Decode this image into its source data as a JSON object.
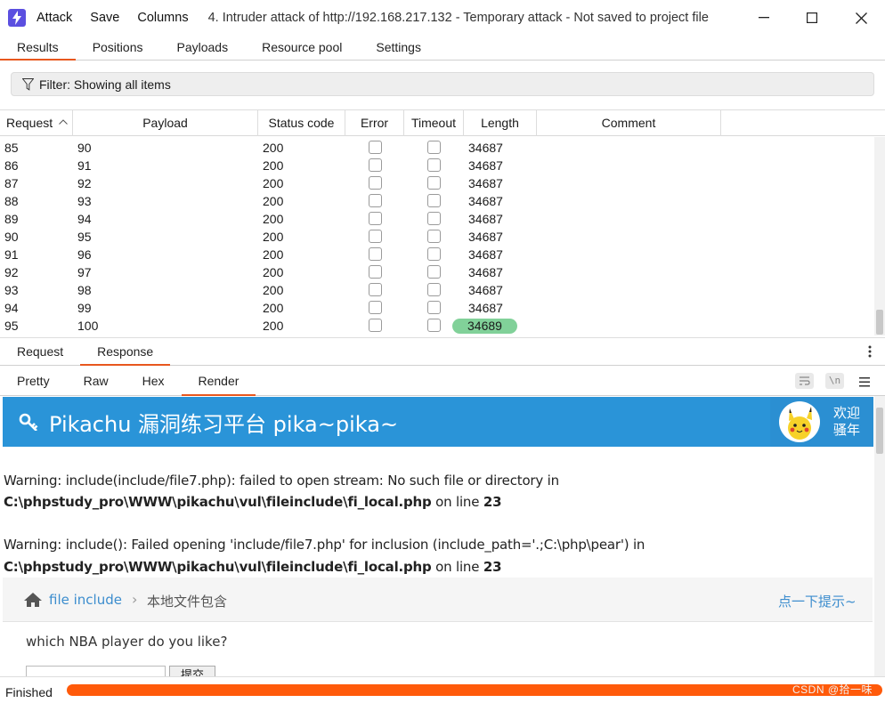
{
  "titlebar": {
    "menu": [
      "Attack",
      "Save",
      "Columns"
    ],
    "title": "4. Intruder attack of http://192.168.217.132 - Temporary attack - Not saved to project file"
  },
  "tabs": [
    "Results",
    "Positions",
    "Payloads",
    "Resource pool",
    "Settings"
  ],
  "filter": {
    "label": "Filter: Showing all items"
  },
  "table": {
    "columns": [
      "Request",
      "Payload",
      "Status code",
      "Error",
      "Timeout",
      "Length",
      "Comment"
    ],
    "rows": [
      {
        "request": "85",
        "payload": "90",
        "status": "200",
        "length": "34687"
      },
      {
        "request": "86",
        "payload": "91",
        "status": "200",
        "length": "34687"
      },
      {
        "request": "87",
        "payload": "92",
        "status": "200",
        "length": "34687"
      },
      {
        "request": "88",
        "payload": "93",
        "status": "200",
        "length": "34687"
      },
      {
        "request": "89",
        "payload": "94",
        "status": "200",
        "length": "34687"
      },
      {
        "request": "90",
        "payload": "95",
        "status": "200",
        "length": "34687"
      },
      {
        "request": "91",
        "payload": "96",
        "status": "200",
        "length": "34687"
      },
      {
        "request": "92",
        "payload": "97",
        "status": "200",
        "length": "34687"
      },
      {
        "request": "93",
        "payload": "98",
        "status": "200",
        "length": "34687"
      },
      {
        "request": "94",
        "payload": "99",
        "status": "200",
        "length": "34687"
      },
      {
        "request": "95",
        "payload": "100",
        "status": "200",
        "length": "34689",
        "highlight": true
      }
    ],
    "highlight_color": "#81d199"
  },
  "reqres_tabs": [
    "Request",
    "Response"
  ],
  "view_tabs": [
    "Pretty",
    "Raw",
    "Hex",
    "Render"
  ],
  "render": {
    "banner_title": "Pikachu 漏洞练习平台 pika~pika~",
    "welcome_1": "欢迎",
    "welcome_2": "骚年",
    "warn1_label": "Warning",
    "warn1_text": ": include(include/file7.php): failed to open stream: No such file or directory in",
    "warn1_path": "C:\\phpstudy_pro\\WWW\\pikachu\\vul\\fileinclude\\fi_local.php",
    "warn1_online": " on line ",
    "warn1_line": "23",
    "warn2_label": "Warning",
    "warn2_text": ": include(): Failed opening 'include/file7.php' for inclusion (include_path='.;C:\\php\\pear') in",
    "warn2_path": "C:\\phpstudy_pro\\WWW\\pikachu\\vul\\fileinclude\\fi_local.php",
    "warn2_online": " on line ",
    "warn2_line": "23",
    "bc_link": "file include",
    "bc_sep": "›",
    "bc_current": "本地文件包含",
    "hint": "点一下提示~",
    "question": "which NBA player do you like?",
    "submit_label": "提交"
  },
  "status": {
    "text": "Finished",
    "progress": 1.0
  },
  "watermark": "CSDN @拾一味"
}
